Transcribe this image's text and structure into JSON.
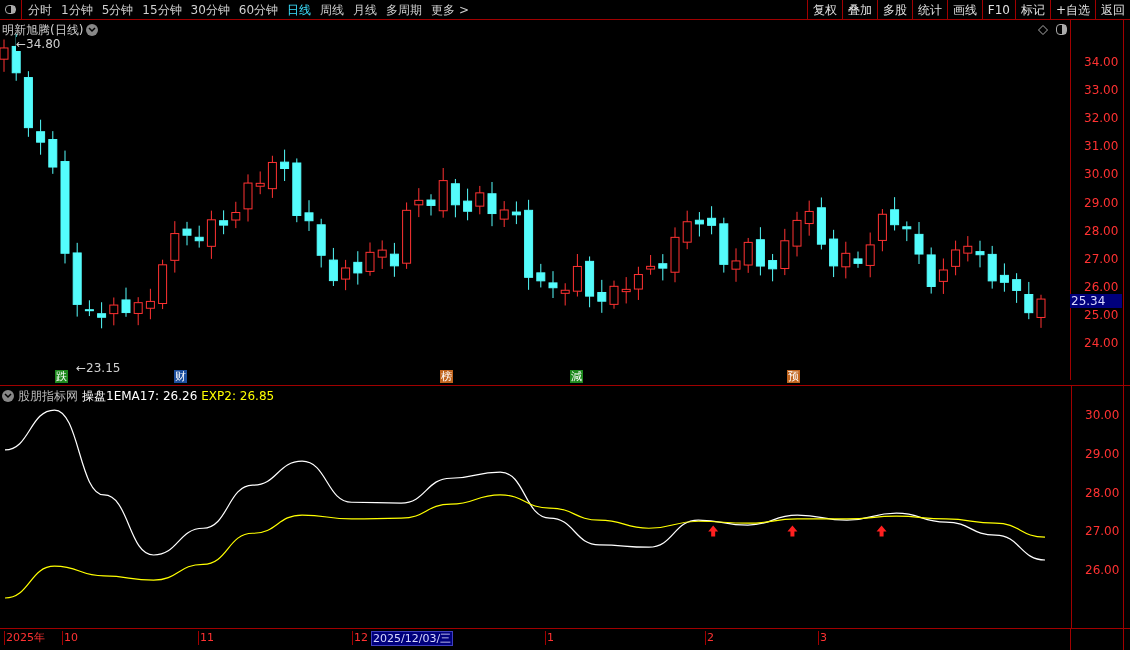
{
  "toolbar": {
    "periods": [
      {
        "label": "分时",
        "selected": false
      },
      {
        "label": "1分钟",
        "selected": false
      },
      {
        "label": "5分钟",
        "selected": false
      },
      {
        "label": "15分钟",
        "selected": false
      },
      {
        "label": "30分钟",
        "selected": false
      },
      {
        "label": "60分钟",
        "selected": false
      },
      {
        "label": "日线",
        "selected": true
      },
      {
        "label": "周线",
        "selected": false
      },
      {
        "label": "月线",
        "selected": false
      },
      {
        "label": "多周期",
        "selected": false
      },
      {
        "label": "更多 >",
        "selected": false
      }
    ],
    "actions": [
      "复权",
      "叠加",
      "多股",
      "统计",
      "画线",
      "F10",
      "标记",
      "+自选",
      "返回"
    ]
  },
  "price_pane": {
    "title": "明新旭腾(日线)",
    "high_label": "←34.80",
    "low_label": "←23.15",
    "current_price": "25.34",
    "ticks": [
      "34.00",
      "33.00",
      "32.00",
      "31.00",
      "30.00",
      "29.00",
      "28.00",
      "27.00",
      "26.00",
      "25.00",
      "24.00"
    ],
    "markers": [
      {
        "text": "跌",
        "color": "#1e8a1e"
      },
      {
        "text": "财",
        "color": "#1c4f9e"
      },
      {
        "text": "榜",
        "color": "#c0641e"
      },
      {
        "text": "減",
        "color": "#1e8a1e"
      },
      {
        "text": "预",
        "color": "#c0641e"
      }
    ]
  },
  "indicator_pane": {
    "source": "股朋指标网",
    "readouts": [
      ": 26.26",
      ": 26.85"
    ],
    "chart_data": {
      "type": "line",
      "ylim": [
        24.48,
        30.75
      ],
      "yticks": [
        {
          "value": 30,
          "label": "30.00"
        },
        {
          "value": 29,
          "label": "29.00"
        },
        {
          "value": 28,
          "label": "28.00"
        },
        {
          "value": 27,
          "label": "27.00"
        },
        {
          "value": 26,
          "label": "26.00"
        }
      ],
      "series": [
        {
          "name": "操盘1EMA17",
          "color": "#ffffff",
          "values": [
            29.1,
            30.13,
            27.94,
            26.39,
            27.08,
            28.19,
            28.81,
            27.75,
            27.73,
            28.37,
            28.53,
            27.34,
            26.65,
            26.59,
            27.29,
            27.16,
            27.42,
            27.29,
            27.47,
            27.24,
            26.9,
            26.26
          ]
        },
        {
          "name": "EXP2",
          "color": "#ffff00",
          "values": [
            25.28,
            26.1,
            25.85,
            25.74,
            26.15,
            26.95,
            27.42,
            27.32,
            27.34,
            27.7,
            27.94,
            27.6,
            27.29,
            27.08,
            27.26,
            27.21,
            27.32,
            27.32,
            27.39,
            27.32,
            27.21,
            26.85
          ]
        }
      ]
    }
  },
  "time_axis": {
    "labels": [
      "2025年",
      "10",
      "11",
      "12",
      "1",
      "2",
      "3"
    ],
    "cursor_date": "2025/12/03/三"
  }
}
